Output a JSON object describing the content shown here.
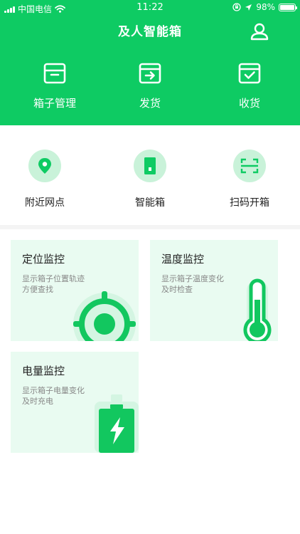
{
  "status_bar": {
    "carrier": "中国电信",
    "time": "11:22",
    "battery_percent": "98%",
    "battery_level": 0.98,
    "icons": [
      "signal-icon",
      "wifi-icon",
      "rotation-lock-icon",
      "location-arrow-icon",
      "battery-icon"
    ]
  },
  "header": {
    "title": "及人智能箱",
    "profile_icon": "user-icon"
  },
  "top_nav": [
    {
      "label": "箱子管理",
      "icon": "box-icon"
    },
    {
      "label": "发货",
      "icon": "ship-out-icon"
    },
    {
      "label": "收货",
      "icon": "receive-check-icon"
    }
  ],
  "secondary_nav": [
    {
      "label": "附近网点",
      "icon": "location-pin-icon"
    },
    {
      "label": "智能箱",
      "icon": "smart-box-icon"
    },
    {
      "label": "扫码开箱",
      "icon": "scan-icon"
    }
  ],
  "cards": [
    {
      "title": "定位监控",
      "desc_line1": "显示箱子位置轨迹",
      "desc_line2": "方便查找",
      "icon": "target-icon"
    },
    {
      "title": "温度监控",
      "desc_line1": "显示箱子温度变化",
      "desc_line2": "及时检查",
      "icon": "thermometer-icon"
    },
    {
      "title": "电量监控",
      "desc_line1": "显示箱子电量变化",
      "desc_line2": "及时充电",
      "icon": "battery-charge-icon"
    }
  ],
  "colors": {
    "primary": "#0ecb63",
    "icon_circle_bg": "#c9f2d9",
    "card_bg": "#e9fbf1",
    "text_dark": "#222222",
    "text_muted": "#888888"
  }
}
